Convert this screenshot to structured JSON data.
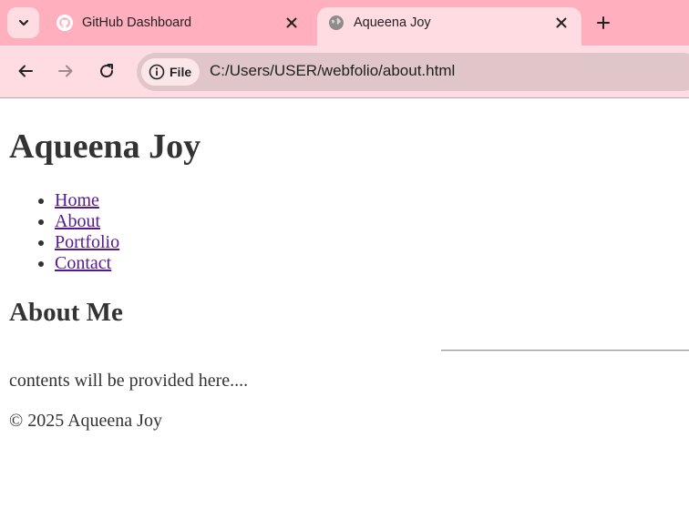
{
  "browser": {
    "tabs": [
      {
        "title": "GitHub Dashboard",
        "icon": "github-icon",
        "active": false
      },
      {
        "title": "Aqueena Joy",
        "icon": "globe-icon",
        "active": true
      }
    ],
    "site_info_label": "File",
    "url": "C:/Users/USER/webfolio/about.html",
    "colors": {
      "tabstrip": "#ffafbd",
      "active_tab": "#ffdce2",
      "omnibox": "#e0c5c9"
    }
  },
  "page": {
    "site_title": "Aqueena Joy",
    "nav": [
      "Home",
      "About",
      "Portfolio",
      "Contact"
    ],
    "section_heading": "About Me",
    "content": "contents will be provided here....",
    "footer": "© 2025 Aqueena Joy",
    "colors": {
      "text": "#333333",
      "link": "#551a8b"
    }
  }
}
